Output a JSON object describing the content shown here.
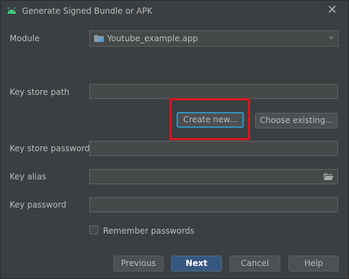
{
  "window": {
    "title": "Generate Signed Bundle or APK",
    "close_glyph": "✕"
  },
  "form": {
    "module_label": "Module",
    "module_value": "Youtube_example.app",
    "keystore_path_label": "Key store path",
    "keystore_path_value": "",
    "create_new_label": "Create new...",
    "choose_existing_label": "Choose existing...",
    "keystore_password_label": "Key store password",
    "keystore_password_value": "",
    "key_alias_label": "Key alias",
    "key_alias_value": "",
    "key_password_label": "Key password",
    "key_password_value": "",
    "remember_label": "Remember passwords",
    "remember_checked": false
  },
  "footer": {
    "previous_label": "Previous",
    "next_label": "Next",
    "cancel_label": "Cancel",
    "help_label": "Help"
  },
  "colors": {
    "background": "#3c3f41",
    "accent": "#365880",
    "highlight": "#e0141c",
    "android": "#3ddc84"
  },
  "icons": [
    "android-icon",
    "close-icon",
    "folder-icon",
    "chevron-down-icon",
    "folder-open-icon",
    "checkbox-icon"
  ]
}
